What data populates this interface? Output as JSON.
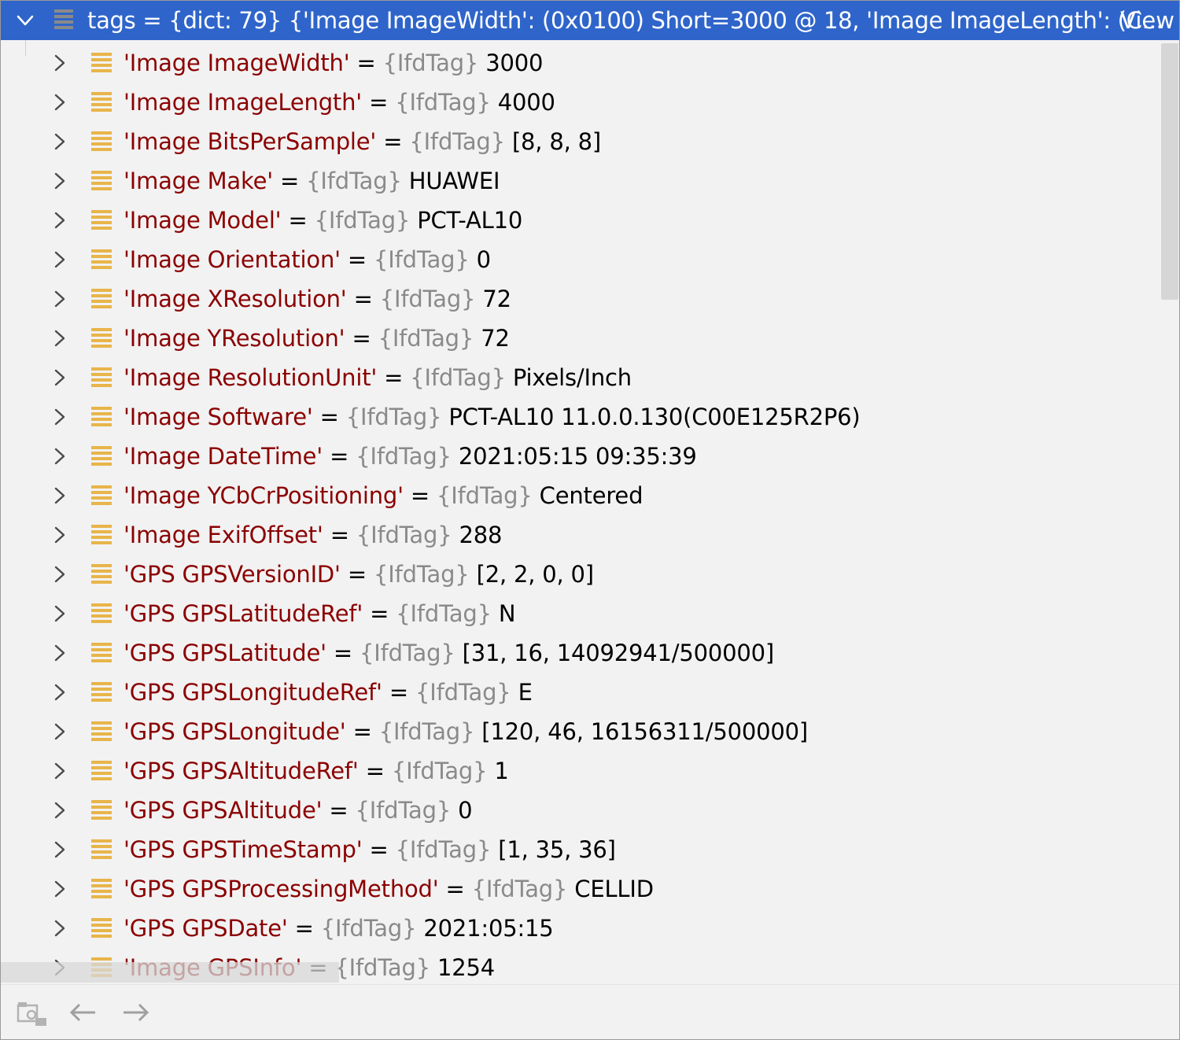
{
  "header": {
    "text": "tags = {dict: 79} {'Image ImageWidth': (0x0100) Short=3000 @ 18, 'Image ImageLength': (C...",
    "view_link": "View"
  },
  "rows": [
    {
      "key": "'Image ImageWidth'",
      "type": "{IfdTag}",
      "value": "3000"
    },
    {
      "key": "'Image ImageLength'",
      "type": "{IfdTag}",
      "value": "4000"
    },
    {
      "key": "'Image BitsPerSample'",
      "type": "{IfdTag}",
      "value": "[8, 8, 8]"
    },
    {
      "key": "'Image Make'",
      "type": "{IfdTag}",
      "value": "HUAWEI"
    },
    {
      "key": "'Image Model'",
      "type": "{IfdTag}",
      "value": "PCT-AL10"
    },
    {
      "key": "'Image Orientation'",
      "type": "{IfdTag}",
      "value": "0"
    },
    {
      "key": "'Image XResolution'",
      "type": "{IfdTag}",
      "value": "72"
    },
    {
      "key": "'Image YResolution'",
      "type": "{IfdTag}",
      "value": "72"
    },
    {
      "key": "'Image ResolutionUnit'",
      "type": "{IfdTag}",
      "value": "Pixels/Inch"
    },
    {
      "key": "'Image Software'",
      "type": "{IfdTag}",
      "value": "PCT-AL10 11.0.0.130(C00E125R2P6)"
    },
    {
      "key": "'Image DateTime'",
      "type": "{IfdTag}",
      "value": "2021:05:15 09:35:39"
    },
    {
      "key": "'Image YCbCrPositioning'",
      "type": "{IfdTag}",
      "value": "Centered"
    },
    {
      "key": "'Image ExifOffset'",
      "type": "{IfdTag}",
      "value": "288"
    },
    {
      "key": "'GPS GPSVersionID'",
      "type": "{IfdTag}",
      "value": "[2, 2, 0, 0]"
    },
    {
      "key": "'GPS GPSLatitudeRef'",
      "type": "{IfdTag}",
      "value": "N"
    },
    {
      "key": "'GPS GPSLatitude'",
      "type": "{IfdTag}",
      "value": "[31, 16, 14092941/500000]"
    },
    {
      "key": "'GPS GPSLongitudeRef'",
      "type": "{IfdTag}",
      "value": "E"
    },
    {
      "key": "'GPS GPSLongitude'",
      "type": "{IfdTag}",
      "value": "[120, 46, 16156311/500000]"
    },
    {
      "key": "'GPS GPSAltitudeRef'",
      "type": "{IfdTag}",
      "value": "1"
    },
    {
      "key": "'GPS GPSAltitude'",
      "type": "{IfdTag}",
      "value": "0"
    },
    {
      "key": "'GPS GPSTimeStamp'",
      "type": "{IfdTag}",
      "value": "[1, 35, 36]"
    },
    {
      "key": "'GPS GPSProcessingMethod'",
      "type": "{IfdTag}",
      "value": "CELLID"
    },
    {
      "key": "'GPS GPSDate'",
      "type": "{IfdTag}",
      "value": "2021:05:15"
    },
    {
      "key": "'Image GPSInfo'",
      "type": "{IfdTag}",
      "value": "1254"
    }
  ],
  "icons": {
    "row_expand": "chevron-right-icon",
    "row_type": "field-lines-icon",
    "header_collapse": "chevron-down-icon",
    "footer_buttons": [
      "folder-view-icon",
      "back-arrow-icon",
      "forward-arrow-icon"
    ]
  },
  "colors": {
    "header_bg": "#2f65ca",
    "key": "#8b0000",
    "type": "#8a8a8a",
    "field_icon": "#e8b54a"
  }
}
